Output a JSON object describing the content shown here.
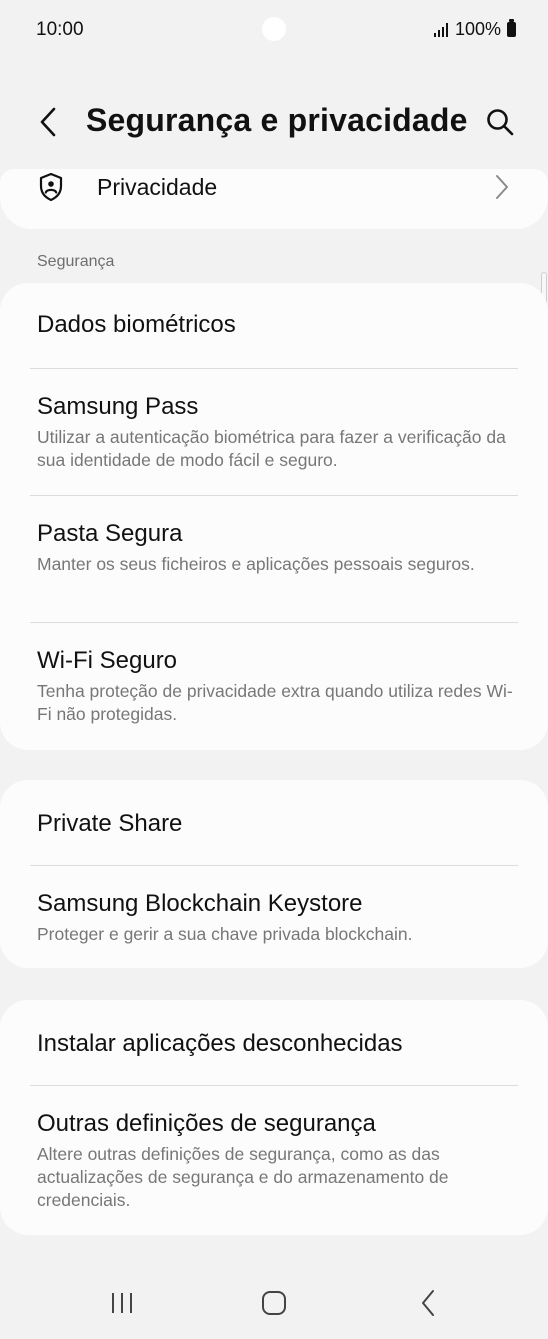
{
  "status_bar": {
    "time": "10:00",
    "battery": "100%"
  },
  "app_bar": {
    "title": "Segurança e privacidade"
  },
  "privacy_item": {
    "label": "Privacidade"
  },
  "section_security": {
    "header": "Segurança"
  },
  "security_items": [
    {
      "title": "Dados biométricos"
    },
    {
      "title": "Samsung Pass",
      "subtitle": "Utilizar a autenticação biométrica para fazer a verificação da sua identidade de modo fácil e seguro."
    },
    {
      "title": "Pasta Segura",
      "subtitle": "Manter os seus ficheiros e aplicações pessoais seguros."
    },
    {
      "title": "Wi-Fi Seguro",
      "subtitle": "Tenha proteção de privacidade extra quando utiliza redes Wi-Fi não protegidas."
    }
  ],
  "sharing_items": [
    {
      "title": "Private Share"
    },
    {
      "title": "Samsung Blockchain Keystore",
      "subtitle": "Proteger e gerir a sua chave privada blockchain."
    }
  ],
  "other_items": [
    {
      "title": "Instalar aplicações desconhecidas"
    },
    {
      "title": "Outras definições de segurança",
      "subtitle": "Altere outras definições de segurança, como as das actualizações de segurança e do armazenamento de credenciais."
    }
  ],
  "icons": {
    "back": "chevron-left-icon",
    "search": "search-icon",
    "privacy": "privacy-shield-icon",
    "chevron": "chevron-right-icon",
    "nav_recents": "recents-icon",
    "nav_home": "home-icon",
    "nav_back": "back-icon"
  }
}
